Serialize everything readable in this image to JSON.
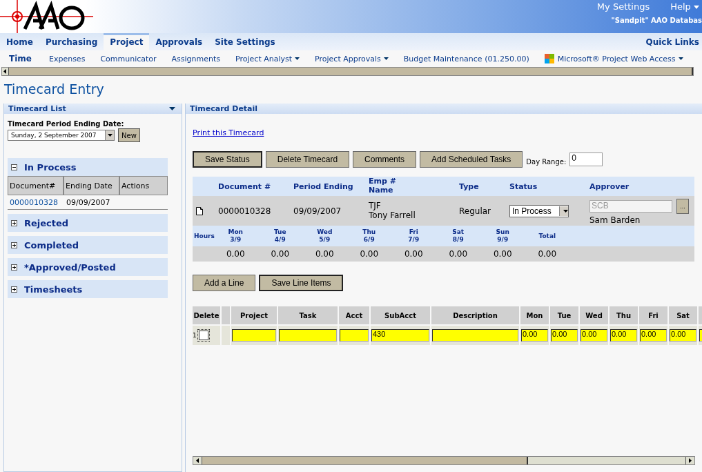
{
  "header": {
    "settings_link": "My Settings",
    "help_link": "Help",
    "database_label": "\"Sandpit\" AAO Databas"
  },
  "main_tabs": [
    {
      "label": "Home",
      "selected": false
    },
    {
      "label": "Purchasing",
      "selected": false
    },
    {
      "label": "Project",
      "selected": true
    },
    {
      "label": "Approvals",
      "selected": false
    },
    {
      "label": "Site Settings",
      "selected": false
    }
  ],
  "quick_links": "Quick Links",
  "sub_tabs": [
    {
      "label": "Time",
      "selected": true,
      "kind": "plain"
    },
    {
      "label": "Expenses",
      "selected": false,
      "kind": "plain"
    },
    {
      "label": "Communicator",
      "selected": false,
      "kind": "plain"
    },
    {
      "label": "Assignments",
      "selected": false,
      "kind": "plain"
    },
    {
      "label": "Project Analyst",
      "selected": false,
      "kind": "dropdown"
    },
    {
      "label": "Project Approvals",
      "selected": false,
      "kind": "dropdown"
    },
    {
      "label": "Budget Maintenance (01.250.00)",
      "selected": false,
      "kind": "plain"
    },
    {
      "label": "Microsoft® Project Web Access",
      "selected": false,
      "kind": "app"
    }
  ],
  "page_title": "Timecard Entry",
  "timecard_list": {
    "title": "Timecard List",
    "period_label": "Timecard Period Ending Date:",
    "period_value": "Sunday, 2 September 2007",
    "new_button": "New",
    "groups": [
      {
        "title": "In Process",
        "expanded": true,
        "columns": [
          "Document#",
          "Ending Date",
          "Actions"
        ],
        "rows": [
          {
            "document": "0000010328",
            "ending_date": "09/09/2007"
          }
        ]
      },
      {
        "title": "Rejected",
        "expanded": false
      },
      {
        "title": "Completed",
        "expanded": false
      },
      {
        "title": "*Approved/Posted",
        "expanded": false
      },
      {
        "title": "Timesheets",
        "expanded": false
      }
    ]
  },
  "timecard_detail": {
    "title": "Timecard Detail",
    "print_link": "Print this Timecard",
    "buttons": [
      "Save Status",
      "Delete Timecard",
      "Comments",
      "Add Scheduled Tasks"
    ],
    "day_range_label": "Day Range:",
    "day_range_value": "0",
    "summary": {
      "columns": [
        "Document #",
        "Period Ending",
        "Emp #",
        "Name",
        "Type",
        "Status",
        "Approver"
      ],
      "document": "0000010328",
      "period_ending": "09/09/2007",
      "emp_code": "TJF",
      "emp_name": "Tony Farrell",
      "type": "Regular",
      "status": "In Process",
      "approver_code": "SCB",
      "approver_name": "Sam Barden",
      "approver_button": "..."
    },
    "hours": {
      "label": "Hours",
      "days": [
        {
          "day": "Mon",
          "date": "3/9"
        },
        {
          "day": "Tue",
          "date": "4/9"
        },
        {
          "day": "Wed",
          "date": "5/9"
        },
        {
          "day": "Thu",
          "date": "6/9"
        },
        {
          "day": "Fri",
          "date": "7/9"
        },
        {
          "day": "Sat",
          "date": "8/9"
        },
        {
          "day": "Sun",
          "date": "9/9"
        }
      ],
      "total_label": "Total",
      "values": [
        "0.00",
        "0.00",
        "0.00",
        "0.00",
        "0.00",
        "0.00",
        "0.00"
      ],
      "total": "0.00"
    },
    "line_buttons": [
      "Add a Line",
      "Save Line Items"
    ],
    "lines": {
      "columns": [
        "Delete",
        "Project",
        "Task",
        "Acct",
        "SubAcct",
        "Description",
        "Mon",
        "Tue",
        "Wed",
        "Thu",
        "Fri",
        "Sat"
      ],
      "rows": [
        {
          "number": "1",
          "delete_checked": false,
          "project": "",
          "task": "",
          "acct": "",
          "subacct": "430",
          "description": "",
          "hours": [
            "0.00",
            "0.00",
            "0.00",
            "0.00",
            "0.00",
            "0.00"
          ]
        }
      ]
    }
  }
}
